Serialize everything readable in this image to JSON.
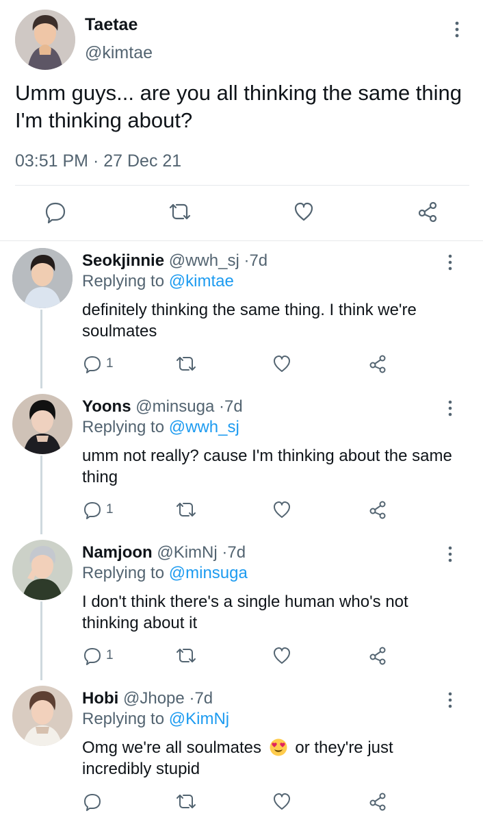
{
  "colors": {
    "text": "#0f1419",
    "secondary": "#536471",
    "link": "#1d9bf0",
    "border": "#e6e9eb",
    "thread_line": "#cfd9de"
  },
  "main_tweet": {
    "name": "Taetae",
    "handle": "@kimtae",
    "text": "Umm guys... are you all thinking the same thing I'm thinking about?",
    "time": "03:51 PM",
    "separator": "·",
    "date": "27 Dec 21",
    "avatar_icon": "profile-photo",
    "more_icon": "more-vertical-icon",
    "actions": {
      "reply_icon": "reply-icon",
      "retweet_icon": "retweet-icon",
      "like_icon": "like-icon",
      "share_icon": "share-icon"
    }
  },
  "replies": [
    {
      "name": "Seokjinnie",
      "handle": "@wwh_sj",
      "separator": "·",
      "age": "7d",
      "replying_label": "Replying to ",
      "replying_to": "@kimtae",
      "text": "definitely thinking the same thing. I think we're soulmates",
      "reply_count": "1",
      "avatar_icon": "profile-photo"
    },
    {
      "name": "Yoons",
      "handle": "@minsuga",
      "separator": "·",
      "age": "7d",
      "replying_label": "Replying to ",
      "replying_to": "@wwh_sj",
      "text": "umm not really? cause I'm thinking about the same thing",
      "reply_count": "1",
      "avatar_icon": "profile-photo"
    },
    {
      "name": "Namjoon",
      "handle": "@KimNj",
      "separator": "·",
      "age": "7d",
      "replying_label": "Replying to ",
      "replying_to": "@minsuga",
      "text": "I don't think there's a single human who's not thinking about it",
      "reply_count": "1",
      "avatar_icon": "profile-photo"
    },
    {
      "name": "Hobi",
      "handle": "@Jhope",
      "separator": "·",
      "age": "7d",
      "replying_label": "Replying to ",
      "replying_to": "@KimNj",
      "text_before_emoji": "Omg we're all soulmates",
      "emoji_icon": "heart-eyes-emoji",
      "text_after_emoji": "or they're just incredibly stupid",
      "reply_count": "",
      "avatar_icon": "profile-photo"
    }
  ]
}
